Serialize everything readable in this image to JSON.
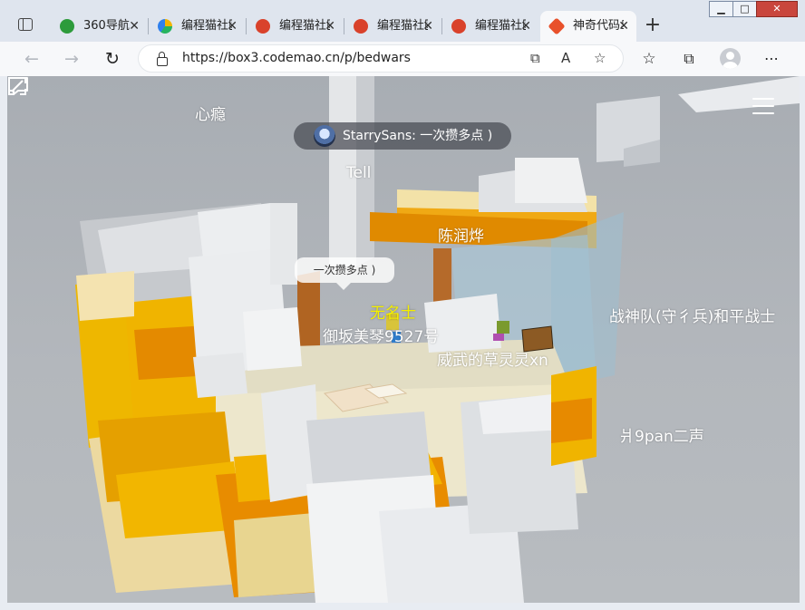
{
  "browser": {
    "tabs": [
      {
        "title": "360导航",
        "favicon_color": "#2d9b3b"
      },
      {
        "title": "编程猫社区",
        "favicon_color": "#27b35f"
      },
      {
        "title": "编程猫社区",
        "favicon_color": "#d9422b"
      },
      {
        "title": "编程猫社区",
        "favicon_color": "#d9422b"
      },
      {
        "title": "编程猫社区",
        "favicon_color": "#d9422b"
      },
      {
        "title": "神奇代码岛",
        "favicon_color": "#e8512b"
      }
    ],
    "active_tab_index": 5,
    "close_glyph": "✕",
    "new_tab_glyph": "+",
    "url": "https://box3.codemao.cn/p/bedwars",
    "window_controls": {
      "minimize": "▁",
      "maximize": "□",
      "close": "✕"
    }
  },
  "game": {
    "chat_message": "StarrySans: 一次攒多点 )",
    "speech_bubble": "一次攒多点 )",
    "player_names": [
      {
        "name": "心瘾",
        "highlight": false
      },
      {
        "name": "Tell",
        "highlight": false
      },
      {
        "name": "陈润烨",
        "highlight": false
      },
      {
        "name": "无名士",
        "highlight": true
      },
      {
        "name": "御坂美琴9527号",
        "highlight": false
      },
      {
        "name": "威武的草灵灵xn",
        "highlight": false
      },
      {
        "name": "战神队(守彳兵)和平战士",
        "highlight": false
      },
      {
        "name": "爿9pan二声",
        "highlight": false
      }
    ]
  }
}
